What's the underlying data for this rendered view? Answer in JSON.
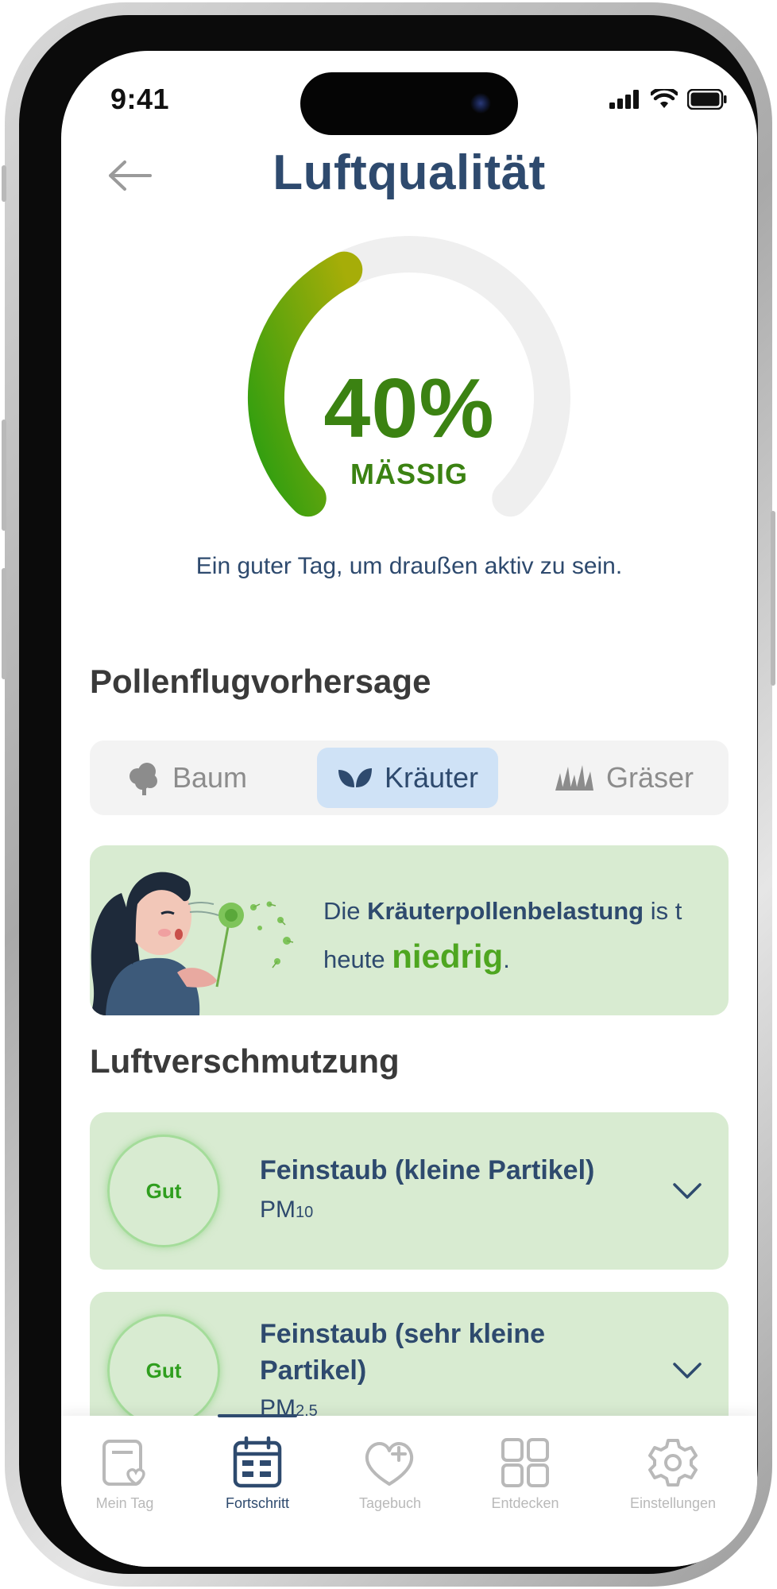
{
  "status_bar": {
    "time": "9:41"
  },
  "header": {
    "title": "Luftqualität"
  },
  "gauge": {
    "value_text": "40%",
    "fraction": 0.4,
    "status": "MÄSSIG",
    "caption": "Ein guter Tag, um draußen aktiv zu sein.",
    "colors": {
      "start": "#2e9e10",
      "end": "#a6ad08",
      "track": "#efefef"
    }
  },
  "pollen": {
    "section_title": "Pollenflugvorhersage",
    "tabs": [
      {
        "label": "Baum",
        "icon": "tree-icon",
        "active": false
      },
      {
        "label": "Kräuter",
        "icon": "leaf-icon",
        "active": true
      },
      {
        "label": "Gräser",
        "icon": "grass-icon",
        "active": false
      }
    ],
    "message": {
      "prefix": "Die ",
      "highlight": "Kräuterpollenbelastung",
      "middle": " is t heute ",
      "level": "niedrig",
      "suffix": "."
    }
  },
  "pollution": {
    "section_title": "Luftverschmutzung",
    "items": [
      {
        "rating": "Gut",
        "title": "Feinstaub (kleine Partikel)",
        "code_main": "PM",
        "code_sub": "10"
      },
      {
        "rating": "Gut",
        "title": "Feinstaub (sehr kleine Partikel)",
        "code_main": "PM",
        "code_sub": "2.5"
      }
    ]
  },
  "tabbar": {
    "items": [
      {
        "label": "Mein Tag",
        "icon": "calendar-heart-icon",
        "active": false
      },
      {
        "label": "Fortschritt",
        "icon": "calendar-grid-icon",
        "active": true
      },
      {
        "label": "Tagebuch",
        "icon": "heart-plus-icon",
        "active": false
      },
      {
        "label": "Entdecken",
        "icon": "grid-icon",
        "active": false
      },
      {
        "label": "Einstellungen",
        "icon": "gear-icon",
        "active": false
      }
    ]
  },
  "colors": {
    "primary": "#2e4a6e",
    "good_green": "#3b8212",
    "card_green": "#d8ebd1",
    "active_tab_bg": "#cfe2f6"
  }
}
